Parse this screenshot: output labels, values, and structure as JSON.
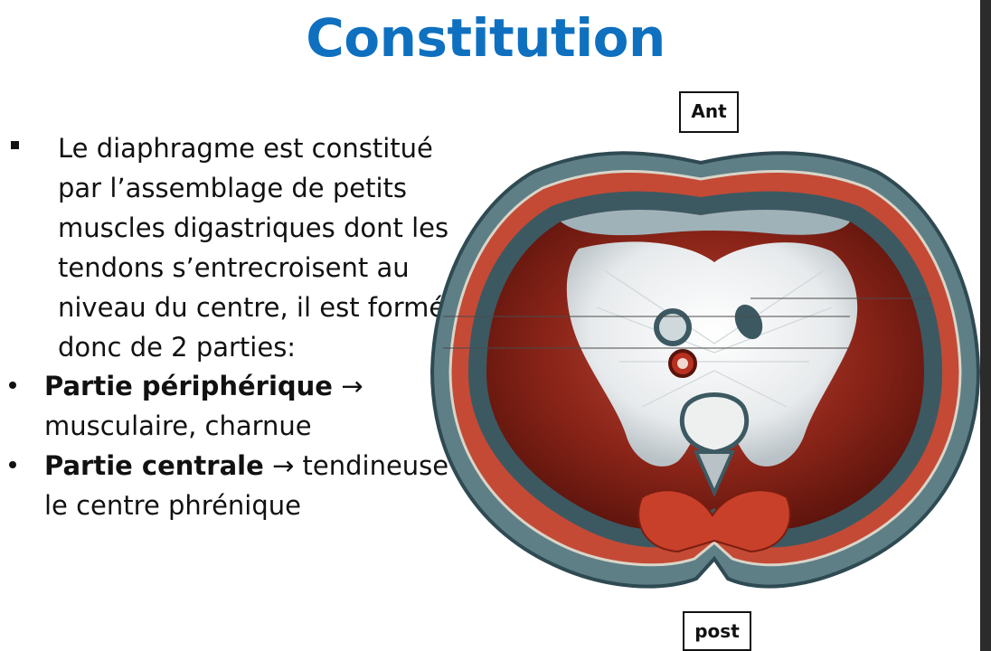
{
  "slide": {
    "title": "Constitution",
    "intro_lines": [
      "Le diaphragme est constitué",
      "par l’assemblage de petits",
      "muscles digastriques dont les",
      "tendons s’entrecroisent au",
      "niveau du centre, il est formé",
      "donc de 2 parties:"
    ],
    "items": [
      {
        "term": "Partie périphérique",
        "arrow": " → ",
        "rest_line1": "",
        "line2": "musculaire, charnue"
      },
      {
        "term": "Partie centrale",
        "arrow": " → ",
        "rest_line1": "tendineuse =",
        "line2": "le centre phrénique"
      }
    ],
    "labels": {
      "anterior": "Ant",
      "posterior": "post"
    }
  },
  "colors": {
    "title": "#0f70c0",
    "muscle": "#8a2418",
    "tendon": "#e7eaec",
    "outline": "#3c5962"
  },
  "figure": {
    "icon": "diaphragm-anatomy-illustration"
  }
}
